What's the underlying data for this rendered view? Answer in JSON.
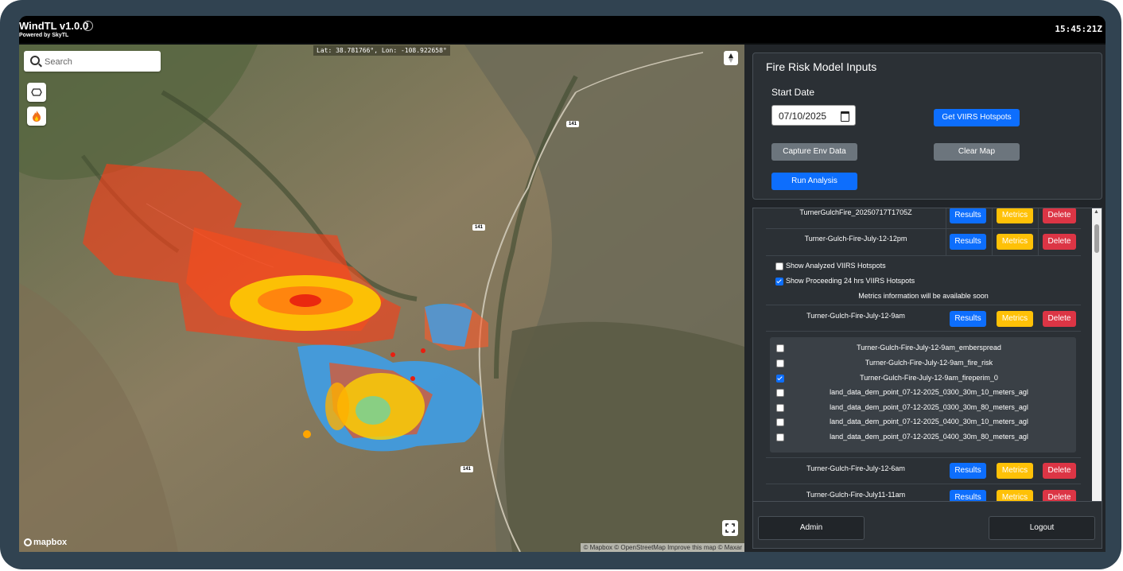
{
  "app": {
    "title": "WindTL v1.0.0",
    "subtitle": "Powered by SkyTL",
    "clock": "15:45:21Z"
  },
  "map": {
    "search_placeholder": "Search",
    "coords": "Lat: 38.781766°, Lon: -108.922658°",
    "road_label": "141",
    "mapbox_logo": "mapbox",
    "attribution": "© Mapbox © OpenStreetMap  Improve this map © Maxar"
  },
  "inputs": {
    "title": "Fire Risk Model Inputs",
    "start_date_label": "Start Date",
    "start_date_value": "07/10/2025",
    "get_viirs_label": "Get VIIRS Hotspots",
    "capture_env_label": "Capture Env Data",
    "clear_map_label": "Clear Map",
    "run_analysis_label": "Run Analysis"
  },
  "results": {
    "results_label": "Results",
    "metrics_label": "Metrics",
    "delete_label": "Delete",
    "rows": [
      {
        "name": "TurnerGulchFire_20250717T1705Z"
      },
      {
        "name": "Turner-Gulch-Fire-July-12-12pm"
      },
      {
        "name": "Turner-Gulch-Fire-July-12-9am"
      },
      {
        "name": "Turner-Gulch-Fire-July-12-6am"
      },
      {
        "name": "Turner-Gulch-Fire-July11-11am"
      }
    ],
    "options": [
      {
        "label": "Show Analyzed VIIRS Hotspots",
        "checked": false
      },
      {
        "label": "Show Proceeding 24 hrs VIIRS Hotspots",
        "checked": true
      }
    ],
    "metrics_note": "Metrics information will be available soon",
    "layers": [
      {
        "label": "Turner-Gulch-Fire-July-12-9am_emberspread",
        "checked": false
      },
      {
        "label": "Turner-Gulch-Fire-July-12-9am_fire_risk",
        "checked": false
      },
      {
        "label": "Turner-Gulch-Fire-July-12-9am_fireperim_0",
        "checked": true
      },
      {
        "label": "land_data_dem_point_07-12-2025_0300_30m_10_meters_agl",
        "checked": false
      },
      {
        "label": "land_data_dem_point_07-12-2025_0300_30m_80_meters_agl",
        "checked": false
      },
      {
        "label": "land_data_dem_point_07-12-2025_0400_30m_10_meters_agl",
        "checked": false
      },
      {
        "label": "land_data_dem_point_07-12-2025_0400_30m_80_meters_agl",
        "checked": false
      }
    ]
  },
  "footer": {
    "admin_label": "Admin",
    "logout_label": "Logout"
  },
  "colors": {
    "primary": "#0d6efd",
    "warning": "#ffc107",
    "danger": "#dc3545",
    "secondary": "#6c757d",
    "panel_bg": "#212529"
  }
}
